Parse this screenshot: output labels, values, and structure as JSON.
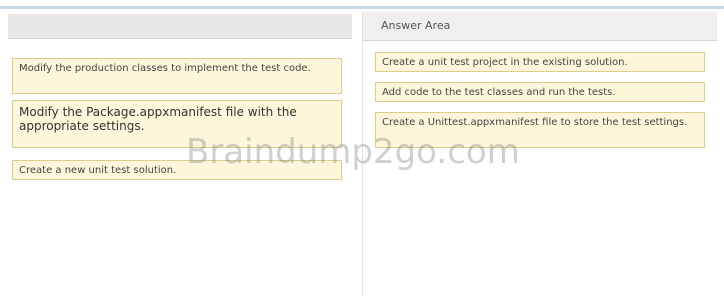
{
  "answer_area": {
    "title": "Answer Area"
  },
  "source_items": [
    "Modify the production classes to implement the test code.",
    "Modify the Package.appxmanifest file with the appropriate settings.",
    "Create a new unit test solution."
  ],
  "answer_items": [
    "Create a unit test project in the existing solution.",
    "Add code to the test classes and run the tests.",
    "Create a Unittest.appxmanifest file to store the test settings."
  ],
  "watermark": "Braindump2go.com"
}
